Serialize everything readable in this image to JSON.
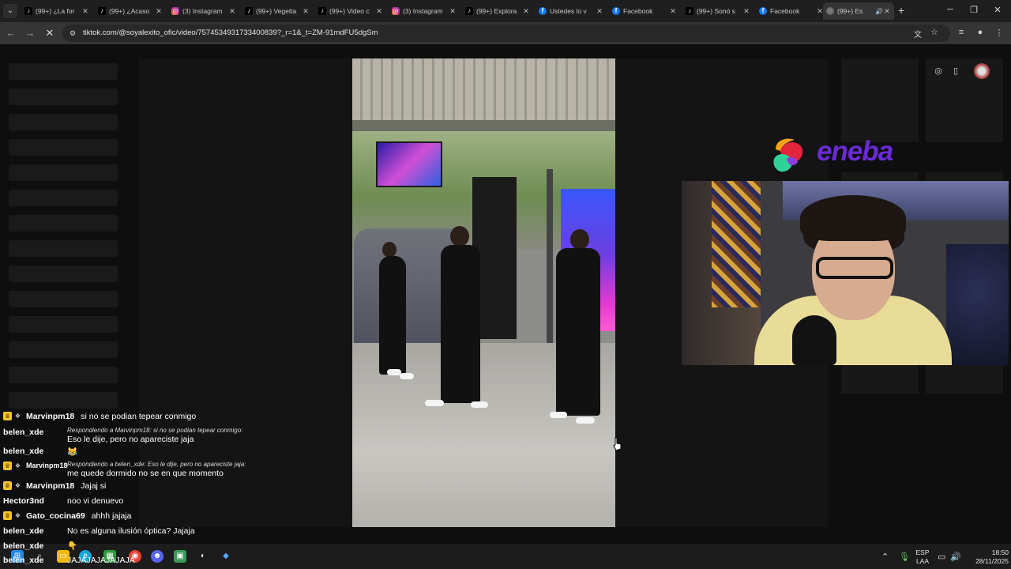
{
  "browser": {
    "tabs": [
      {
        "title": "(99+) ¿La for",
        "icon": "tiktok-icon",
        "kind": "tt"
      },
      {
        "title": "(99+) ¿Acaso",
        "icon": "tiktok-icon",
        "kind": "tt"
      },
      {
        "title": "(3) Instagram",
        "icon": "instagram-icon",
        "kind": "ig"
      },
      {
        "title": "(99+) Vegetta",
        "icon": "tiktok-icon",
        "kind": "tt"
      },
      {
        "title": "(99+) Video c",
        "icon": "tiktok-icon",
        "kind": "tt"
      },
      {
        "title": "(3) Instagram",
        "icon": "instagram-icon",
        "kind": "ig"
      },
      {
        "title": "(99+) Explora",
        "icon": "tiktok-icon",
        "kind": "tt"
      },
      {
        "title": "Ustedes lo v",
        "icon": "facebook-icon",
        "kind": "fb"
      },
      {
        "title": "Facebook",
        "icon": "facebook-icon",
        "kind": "fb"
      },
      {
        "title": "(99+) Sonó s",
        "icon": "tiktok-icon",
        "kind": "tt"
      },
      {
        "title": "Facebook",
        "icon": "facebook-icon",
        "kind": "fb"
      },
      {
        "title": "(99+) Es",
        "icon": "loading-icon",
        "kind": "gl",
        "active": true
      }
    ],
    "url": "tiktok.com/@soyalexito_ofic/video/7574534931733400839?_r=1&_t=ZM-91mdFU5dgSm"
  },
  "chat": [
    {
      "user": "Marvinpm18",
      "badges": true,
      "msg": "si no se podian tepear conmigo"
    },
    {
      "user": "belen_xde",
      "badges": false,
      "reply": "Respondiendo a Marvinpm18: si no se podian tepear conmigo:",
      "msg": "Eso le dije, pero no apareciste jaja"
    },
    {
      "user": "belen_xde",
      "badges": false,
      "msg": "😹"
    },
    {
      "user": "Marvinpm18",
      "badges": true,
      "reply": "Respondiendo a belen_xde: Eso le dije, pero no apareciste jaja:",
      "msg": "me quede dormido no se en que momento"
    },
    {
      "user": "Marvinpm18",
      "badges": true,
      "msg": "Jajaj si"
    },
    {
      "user": "Hector3nd",
      "badges": false,
      "msg": "noo vi denuevo"
    },
    {
      "user": "Gato_cocina69",
      "badges": true,
      "msg": "ahhh jajaja"
    },
    {
      "user": "belen_xde",
      "badges": false,
      "msg": "No es alguna ilusión óptica? Jajaja"
    },
    {
      "user": "belen_xde",
      "badges": false,
      "msg": "👇"
    },
    {
      "user": "belen_xde",
      "badges": false,
      "msg": "JAJAJAJAJAJAJA"
    }
  ],
  "overlay": {
    "brand": "eneba"
  },
  "taskbar": {
    "lang_top": "ESP",
    "lang_bottom": "LAA",
    "time": "18:50",
    "date": "28/11/2025"
  }
}
